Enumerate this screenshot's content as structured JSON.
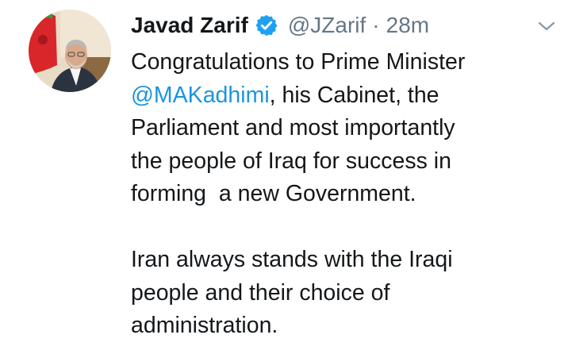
{
  "tweet": {
    "author": {
      "name": "Javad Zarif",
      "handle": "@JZarif",
      "separator": "·",
      "time": "28m"
    },
    "colors": {
      "text": "#14171a",
      "muted": "#657786",
      "link": "#1b95e0",
      "verified": "#1da1f2"
    },
    "text": {
      "p1_l1": "Congratulations to Prime Minister",
      "p1_l2_mention": "@MAKadhimi",
      "p1_l2_rest": ", his Cabinet, the",
      "p1_l3": "Parliament and most importantly",
      "p1_l4": "the people of Iraq for success in",
      "p1_l5": "forming  a new Government.",
      "p2_l1": "Iran always stands with the Iraqi",
      "p2_l2": "people and their choice of",
      "p2_l3": "administration."
    },
    "icons": {
      "verified": "verified-badge-icon",
      "menu": "chevron-down-icon"
    }
  }
}
